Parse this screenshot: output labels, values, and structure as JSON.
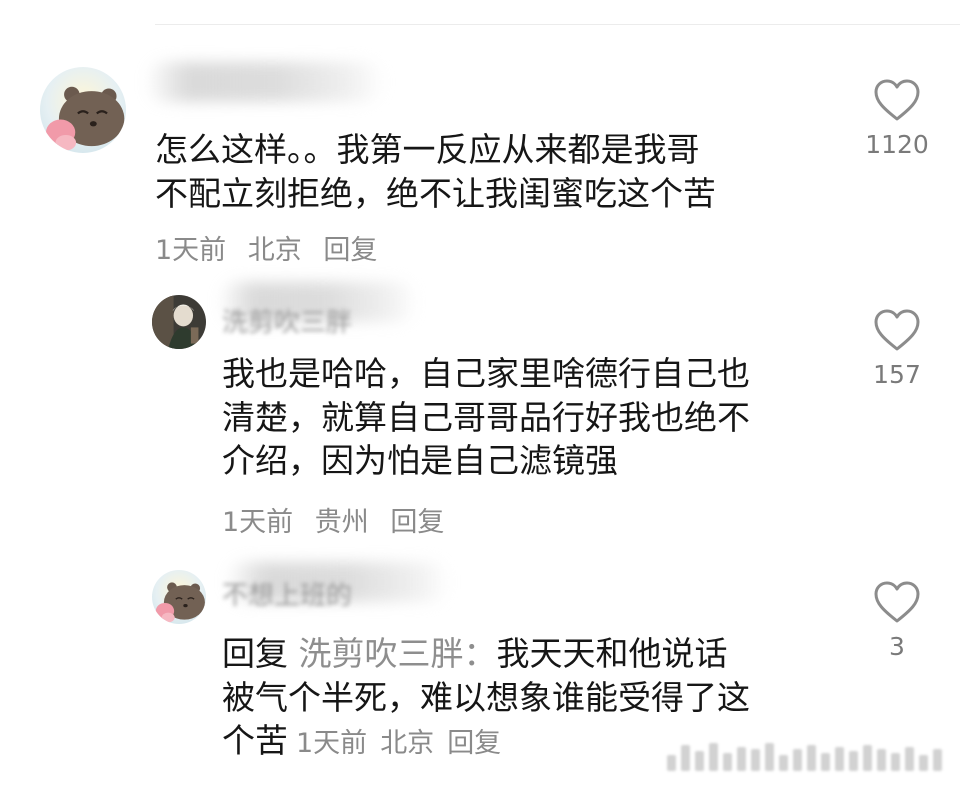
{
  "comments": [
    {
      "author": "",
      "text_lines": [
        "怎么这样。。我第一反应从来都是我哥",
        "不配立刻拒绝，绝不让我闺蜜吃这个苦"
      ],
      "meta": {
        "time": "1天前",
        "location": "北京",
        "reply": "回复"
      },
      "likes": "1120"
    },
    {
      "author": "洗剪吹三胖",
      "text_lines": [
        "我也是哈哈，自己家里啥德行自己也",
        "清楚，就算自己哥哥品行好我也绝不",
        "介绍，因为怕是自己滤镜强"
      ],
      "meta": {
        "time": "1天前",
        "location": "贵州",
        "reply": "回复"
      },
      "likes": "157"
    },
    {
      "author": "不想上班的",
      "reply_prefix": "回复",
      "reply_target": "洗剪吹三胖：",
      "text_first_rest": "我天天和他说话",
      "text_lines": [
        "被气个半死，难以想象谁能受得了这",
        "个苦"
      ],
      "meta": {
        "time": "1天前",
        "location": "北京",
        "reply": "回复"
      },
      "likes": "3"
    }
  ],
  "icons": {
    "like": "heart-outline-icon",
    "avatar_bear": "bear-avatar",
    "avatar_person": "person-avatar"
  },
  "colors": {
    "text": "#161616",
    "secondary": "#8a8a8a",
    "icon": "#8c8c8c"
  }
}
